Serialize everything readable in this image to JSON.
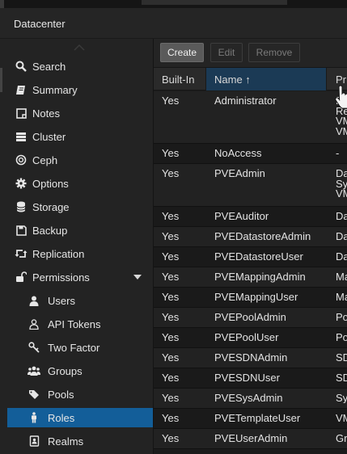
{
  "header": {
    "title": "Datacenter"
  },
  "sidebar": {
    "items": [
      {
        "label": "Search",
        "icon": "search-icon"
      },
      {
        "label": "Summary",
        "icon": "book-icon"
      },
      {
        "label": "Notes",
        "icon": "note-icon"
      },
      {
        "label": "Cluster",
        "icon": "server-icon"
      },
      {
        "label": "Ceph",
        "icon": "ceph-icon"
      },
      {
        "label": "Options",
        "icon": "gear-icon"
      },
      {
        "label": "Storage",
        "icon": "database-icon"
      },
      {
        "label": "Backup",
        "icon": "floppy-icon"
      },
      {
        "label": "Replication",
        "icon": "retweet-icon"
      },
      {
        "label": "Permissions",
        "icon": "unlock-icon"
      },
      {
        "label": "Users",
        "icon": "user-icon"
      },
      {
        "label": "API Tokens",
        "icon": "user-outline-icon"
      },
      {
        "label": "Two Factor",
        "icon": "key-icon"
      },
      {
        "label": "Groups",
        "icon": "users-icon"
      },
      {
        "label": "Pools",
        "icon": "tags-icon"
      },
      {
        "label": "Roles",
        "icon": "male-icon"
      },
      {
        "label": "Realms",
        "icon": "address-book-icon"
      }
    ],
    "active": "Roles"
  },
  "toolbar": {
    "create_label": "Create",
    "edit_label": "Edit",
    "remove_label": "Remove"
  },
  "grid": {
    "columns": [
      "Built-In",
      "Name ↑",
      "Pr"
    ],
    "rows": [
      {
        "builtin": "Yes",
        "name": "Administrator",
        "priv": [
          "Da",
          "Re",
          "VM",
          "VM"
        ]
      },
      {
        "builtin": "Yes",
        "name": "NoAccess",
        "priv": [
          "-"
        ]
      },
      {
        "builtin": "Yes",
        "name": "PVEAdmin",
        "priv": [
          "Da",
          "Sy",
          "VM"
        ]
      },
      {
        "builtin": "Yes",
        "name": "PVEAuditor",
        "priv": [
          "Da"
        ]
      },
      {
        "builtin": "Yes",
        "name": "PVEDatastoreAdmin",
        "priv": [
          "Da"
        ]
      },
      {
        "builtin": "Yes",
        "name": "PVEDatastoreUser",
        "priv": [
          "Da"
        ]
      },
      {
        "builtin": "Yes",
        "name": "PVEMappingAdmin",
        "priv": [
          "Ma"
        ]
      },
      {
        "builtin": "Yes",
        "name": "PVEMappingUser",
        "priv": [
          "Ma"
        ]
      },
      {
        "builtin": "Yes",
        "name": "PVEPoolAdmin",
        "priv": [
          "Po"
        ]
      },
      {
        "builtin": "Yes",
        "name": "PVEPoolUser",
        "priv": [
          "Po"
        ]
      },
      {
        "builtin": "Yes",
        "name": "PVESDNAdmin",
        "priv": [
          "SD"
        ]
      },
      {
        "builtin": "Yes",
        "name": "PVESDNUser",
        "priv": [
          "SD"
        ]
      },
      {
        "builtin": "Yes",
        "name": "PVESysAdmin",
        "priv": [
          "Sy"
        ]
      },
      {
        "builtin": "Yes",
        "name": "PVETemplateUser",
        "priv": [
          "VM"
        ]
      },
      {
        "builtin": "Yes",
        "name": "PVEUserAdmin",
        "priv": [
          "Gr"
        ]
      }
    ]
  },
  "colors": {
    "accent": "#135e99",
    "sorted_header": "#1b3a55"
  }
}
